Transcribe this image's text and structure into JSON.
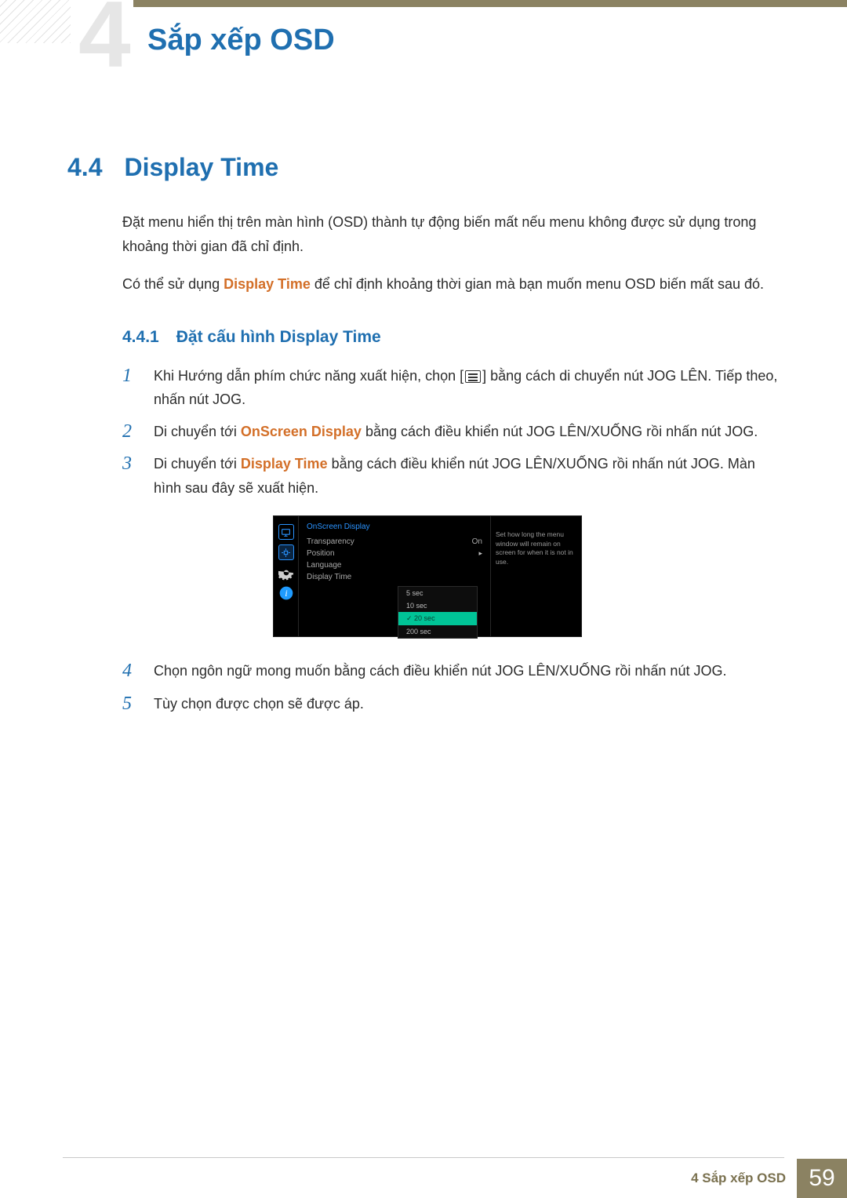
{
  "header": {
    "chapter_bg_number": "4",
    "page_title": "Sắp xếp OSD"
  },
  "section": {
    "number": "4.4",
    "title": "Display Time"
  },
  "intro_paragraphs": {
    "p1": "Đặt menu hiển thị trên màn hình (OSD) thành tự động biến mất nếu menu không được sử dụng trong khoảng thời gian đã chỉ định.",
    "p2_before": "Có thể sử dụng ",
    "p2_bold": "Display Time",
    "p2_after": " để chỉ định khoảng thời gian mà bạn muốn menu OSD biến mất sau đó."
  },
  "subsection": {
    "number": "4.4.1",
    "title": "Đặt cấu hình Display Time"
  },
  "steps": [
    {
      "before": "Khi Hướng dẫn phím chức năng xuất hiện, chọn [",
      "after": "] bằng cách di chuyển nút JOG LÊN. Tiếp theo, nhấn nút JOG.",
      "has_icon": true
    },
    {
      "before": "Di chuyển tới ",
      "bold": "OnScreen Display",
      "after": " bằng cách điều khiển nút JOG LÊN/XUỐNG rồi nhấn nút JOG."
    },
    {
      "before": "Di chuyển tới ",
      "bold": "Display Time",
      "after": " bằng cách điều khiển nút JOG LÊN/XUỐNG rồi nhấn nút JOG. Màn hình sau đây sẽ xuất hiện.",
      "has_osd_after": true
    },
    {
      "before": "Chọn ngôn ngữ mong muốn bằng cách điều khiển nút JOG LÊN/XUỐNG rồi nhấn nút JOG."
    },
    {
      "before": "Tùy chọn được chọn sẽ được áp."
    }
  ],
  "osd": {
    "menu_title": "OnScreen Display",
    "items": [
      {
        "label": "Transparency",
        "value": "On"
      },
      {
        "label": "Position",
        "value": "▸"
      },
      {
        "label": "Language"
      },
      {
        "label": "Display Time"
      }
    ],
    "popup": [
      "5 sec",
      "10 sec",
      "20 sec",
      "200 sec"
    ],
    "popup_selected_index": 2,
    "help_text": "Set how long the menu window will remain on screen for when it is not in use."
  },
  "footer": {
    "label": "4 Sắp xếp OSD",
    "page_number": "59"
  }
}
